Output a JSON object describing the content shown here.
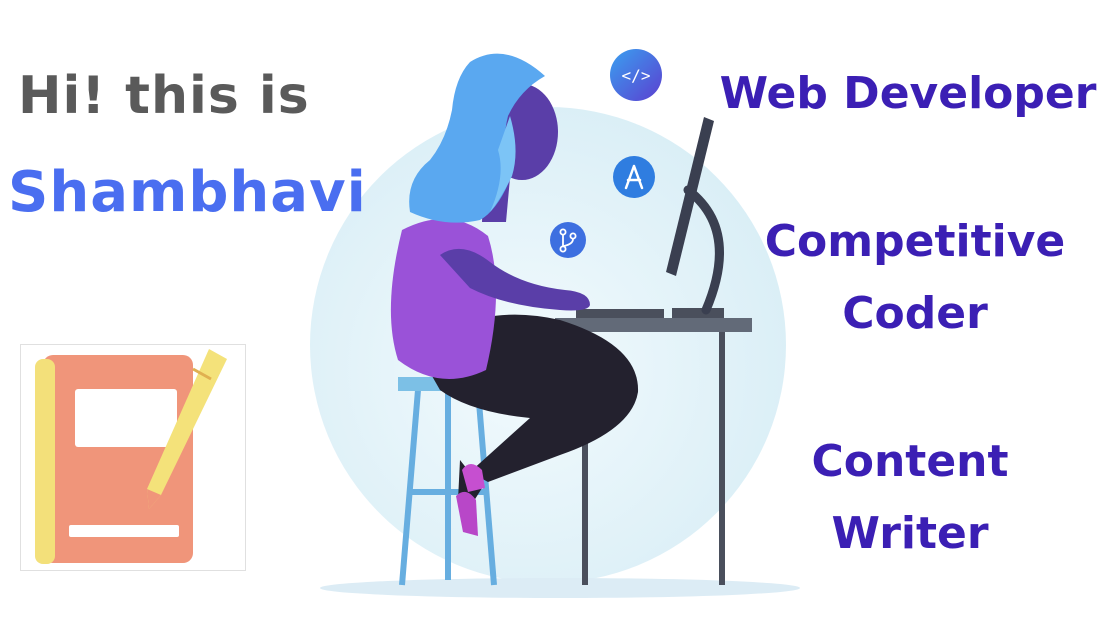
{
  "greeting": {
    "line1": "Hi! this is",
    "name": "Shambhavi"
  },
  "roles": [
    {
      "line1": "Web Developer"
    },
    {
      "line1": "Competitive",
      "line2": "Coder"
    },
    {
      "line1": "Content",
      "line2": "Writer"
    }
  ],
  "floating_icons": [
    "code-icon",
    "design-tool-icon",
    "git-branch-icon"
  ],
  "colors": {
    "greeting": "#5a5a5a",
    "name": "#4a6ef0",
    "roles": "#3b1fb4",
    "hair": "#5aa8f0",
    "shirt": "#9a52d8",
    "skin": "#5a3ea8",
    "pants": "#22202e",
    "circle": "#e2f2f8",
    "book": "#f0957a"
  }
}
